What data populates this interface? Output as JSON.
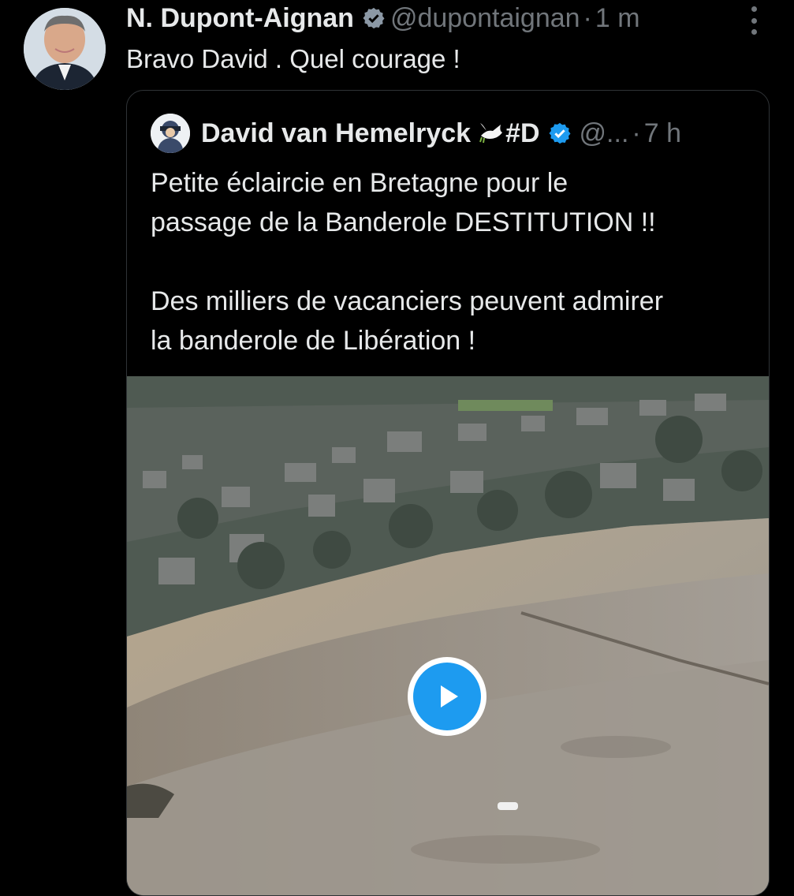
{
  "tweet": {
    "author_name": "N. Dupont-Aignan",
    "handle": "@dupontaignan",
    "separator": "·",
    "time": "1 m",
    "text": "Bravo David . Quel courage !"
  },
  "quoted_tweet": {
    "author_name": "David van Hemelryck",
    "name_tag": "#D",
    "handle": "@...",
    "separator": "·",
    "time": "7 h",
    "paragraph1_line1": "Petite éclaircie en Bretagne pour le",
    "paragraph1_line2": "passage de la Banderole DESTITUTION !!",
    "paragraph2_line1": "Des milliers de vacanciers peuvent admirer",
    "paragraph2_line2": "la banderole de Libération !"
  },
  "icons": {
    "verified": "verified-badge-icon",
    "more": "more-options-icon",
    "dove": "dove-icon",
    "play": "play-icon"
  },
  "colors": {
    "background": "#000000",
    "text_primary": "#e7e9ea",
    "text_secondary": "#71767b",
    "accent": "#1d9bf0",
    "border": "#2f3336"
  }
}
